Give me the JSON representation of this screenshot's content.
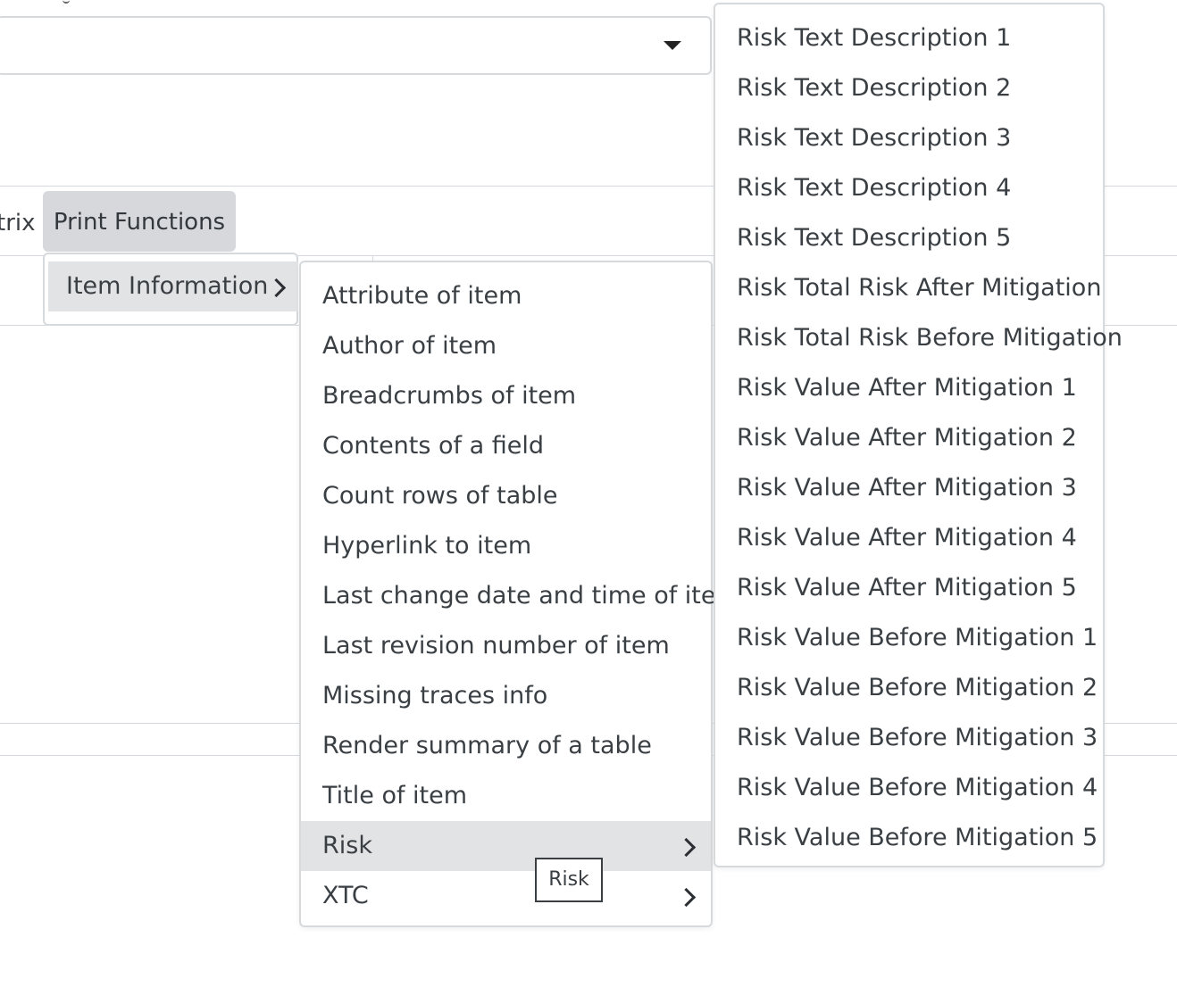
{
  "select": {
    "value": ""
  },
  "menubar": {
    "prev_label": "trix",
    "active_label": "Print Functions"
  },
  "dropdown1": {
    "items": [
      {
        "label": "Item Information"
      }
    ]
  },
  "submenu": {
    "items": [
      {
        "label": "Attribute of item"
      },
      {
        "label": "Author of item"
      },
      {
        "label": "Breadcrumbs of item"
      },
      {
        "label": "Contents of a field"
      },
      {
        "label": "Count rows of table"
      },
      {
        "label": "Hyperlink to item"
      },
      {
        "label": "Last change date and time of item"
      },
      {
        "label": "Last revision number of item"
      },
      {
        "label": "Missing traces info"
      },
      {
        "label": "Render summary of a table"
      },
      {
        "label": "Title of item"
      },
      {
        "label": "Risk"
      },
      {
        "label": "XTC"
      }
    ]
  },
  "tooltip": {
    "text": "Risk"
  },
  "risk_menu": {
    "items": [
      {
        "label": "Risk Text Description 1"
      },
      {
        "label": "Risk Text Description 2"
      },
      {
        "label": "Risk Text Description 3"
      },
      {
        "label": "Risk Text Description 4"
      },
      {
        "label": "Risk Text Description 5"
      },
      {
        "label": "Risk Total Risk After Mitigation"
      },
      {
        "label": "Risk Total Risk Before Mitigation"
      },
      {
        "label": "Risk Value After Mitigation 1"
      },
      {
        "label": "Risk Value After Mitigation 2"
      },
      {
        "label": "Risk Value After Mitigation 3"
      },
      {
        "label": "Risk Value After Mitigation 4"
      },
      {
        "label": "Risk Value After Mitigation 5"
      },
      {
        "label": "Risk Value Before Mitigation 1"
      },
      {
        "label": "Risk Value Before Mitigation 2"
      },
      {
        "label": "Risk Value Before Mitigation 3"
      },
      {
        "label": "Risk Value Before Mitigation 4"
      },
      {
        "label": "Risk Value Before Mitigation 5"
      }
    ]
  },
  "colors": {
    "highlight": "#e2e3e5",
    "active_tab": "#d6d8db",
    "border": "#d7dadd",
    "text": "#3a3f44"
  }
}
